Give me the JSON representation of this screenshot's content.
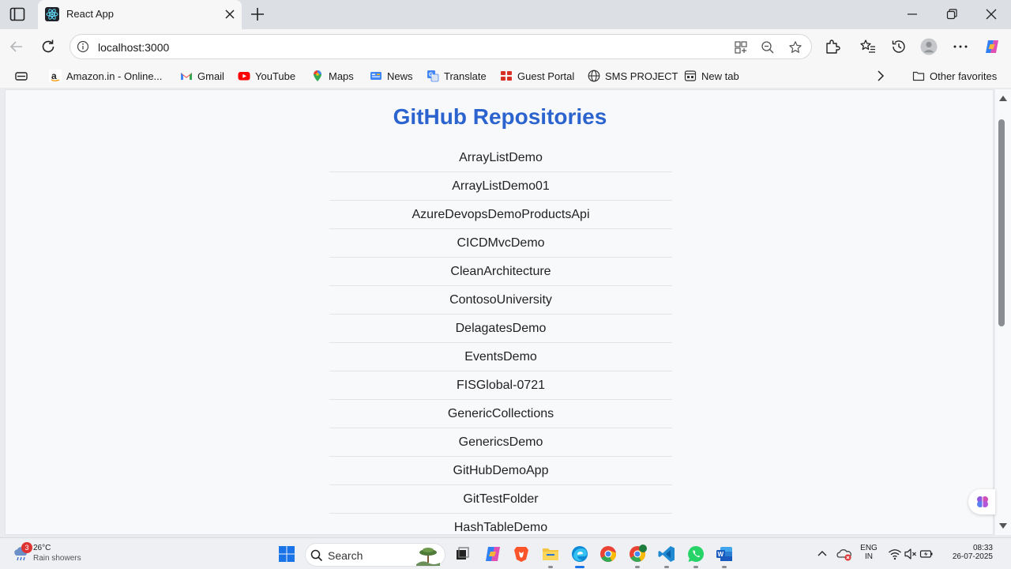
{
  "browser": {
    "tab_title": "React App",
    "address": "localhost:3000"
  },
  "bookmarks": [
    {
      "label": "Amazon.in - Online...",
      "icon": "amazon-icon",
      "color": "#222222"
    },
    {
      "label": "Gmail",
      "icon": "gmail-icon",
      "color": "#ea4335"
    },
    {
      "label": "YouTube",
      "icon": "youtube-icon",
      "color": "#ff0000"
    },
    {
      "label": "Maps",
      "icon": "maps-icon",
      "color": "#34a853"
    },
    {
      "label": "News",
      "icon": "news-icon",
      "color": "#4285f4"
    },
    {
      "label": "Translate",
      "icon": "translate-icon",
      "color": "#4285f4"
    },
    {
      "label": "Guest Portal",
      "icon": "guest-portal-icon",
      "color": "#d93025"
    },
    {
      "label": "SMS PROJECT",
      "icon": "globe-icon",
      "color": "#333333"
    },
    {
      "label": "New tab",
      "icon": "new-tab-icon",
      "color": "#333333"
    }
  ],
  "other_favorites": "Other favorites",
  "page": {
    "title": "GitHub Repositories",
    "title_color": "#2b63cf",
    "repos": [
      "ArrayListDemo",
      "ArrayListDemo01",
      "AzureDevopsDemoProductsApi",
      "CICDMvcDemo",
      "CleanArchitecture",
      "ContosoUniversity",
      "DelagatesDemo",
      "EventsDemo",
      "FISGlobal-0721",
      "GenericCollections",
      "GenericsDemo",
      "GitHubDemoApp",
      "GitTestFolder",
      "HashTableDemo"
    ]
  },
  "taskbar": {
    "weather_badge": "3",
    "weather_temp": "26°C",
    "weather_condition": "Rain showers",
    "search_label": "Search",
    "language_line1": "ENG",
    "language_line2": "IN",
    "time": "08:33",
    "date": "26-07-2025"
  }
}
